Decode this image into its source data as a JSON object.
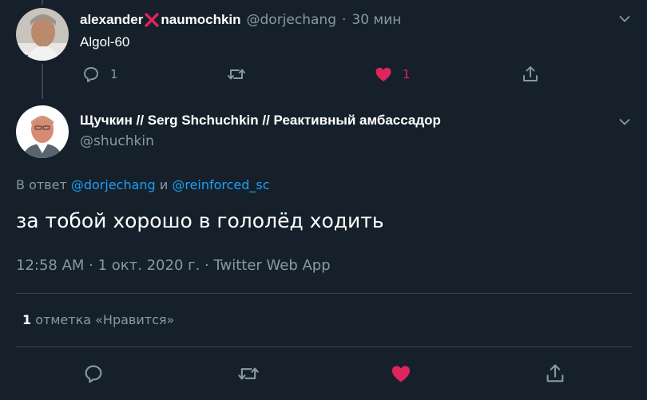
{
  "parent_tweet": {
    "name_part1": "alexander",
    "name_part2": "naumochkin",
    "handle": "@dorjechang",
    "separator": "·",
    "time": "30 мин",
    "text": "Algol-60",
    "reply_count": "1",
    "like_count": "1",
    "liked": true
  },
  "main_tweet": {
    "display_name": "Щучкин // Serg Shchuchkin // Реактивный амбассадор",
    "handle": "@shuchkin",
    "reply_prefix": "В ответ",
    "reply_mention_1": "@dorjechang",
    "reply_conjunction": "и",
    "reply_mention_2": "@reinforced_sc",
    "text": "за тобой хорошо в гололёд ходить",
    "timestamp": "12:58 AM · 1 окт. 2020 г. · Twitter Web App",
    "likes_count": "1",
    "likes_label": "отметка «Нравится»",
    "liked": true
  },
  "colors": {
    "background": "#15202b",
    "primary_text": "#ffffff",
    "secondary_text": "#8899a6",
    "accent": "#1da1f2",
    "like": "#e0245e",
    "divider": "#38444d",
    "name_x_mark": "#e0245e"
  },
  "icons": {
    "reply": "reply-icon",
    "retweet": "retweet-icon",
    "like": "heart-icon",
    "share": "share-icon",
    "caret": "chevron-down-icon"
  }
}
